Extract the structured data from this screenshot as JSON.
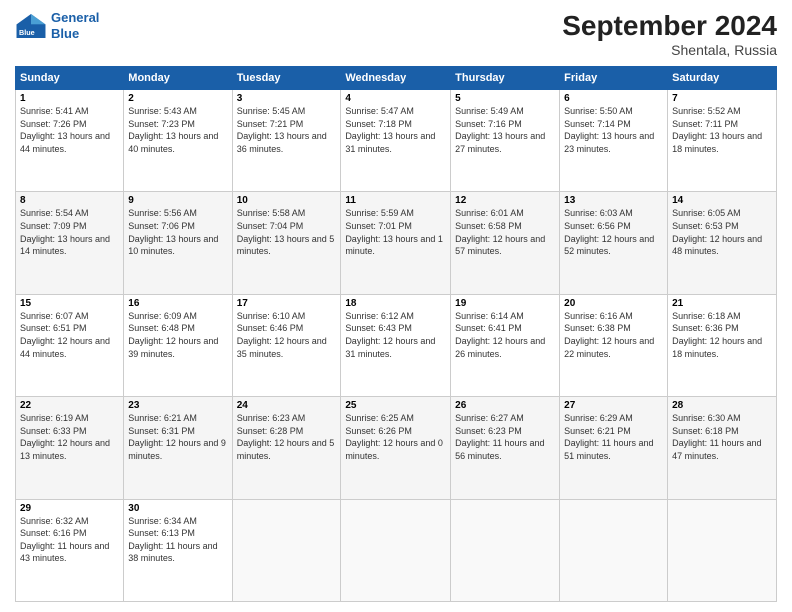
{
  "header": {
    "logo_line1": "General",
    "logo_line2": "Blue",
    "title": "September 2024",
    "subtitle": "Shentala, Russia"
  },
  "columns": [
    "Sunday",
    "Monday",
    "Tuesday",
    "Wednesday",
    "Thursday",
    "Friday",
    "Saturday"
  ],
  "weeks": [
    [
      {
        "day": "1",
        "sunrise": "5:41 AM",
        "sunset": "7:26 PM",
        "daylight": "13 hours and 44 minutes."
      },
      {
        "day": "2",
        "sunrise": "5:43 AM",
        "sunset": "7:23 PM",
        "daylight": "13 hours and 40 minutes."
      },
      {
        "day": "3",
        "sunrise": "5:45 AM",
        "sunset": "7:21 PM",
        "daylight": "13 hours and 36 minutes."
      },
      {
        "day": "4",
        "sunrise": "5:47 AM",
        "sunset": "7:18 PM",
        "daylight": "13 hours and 31 minutes."
      },
      {
        "day": "5",
        "sunrise": "5:49 AM",
        "sunset": "7:16 PM",
        "daylight": "13 hours and 27 minutes."
      },
      {
        "day": "6",
        "sunrise": "5:50 AM",
        "sunset": "7:14 PM",
        "daylight": "13 hours and 23 minutes."
      },
      {
        "day": "7",
        "sunrise": "5:52 AM",
        "sunset": "7:11 PM",
        "daylight": "13 hours and 18 minutes."
      }
    ],
    [
      {
        "day": "8",
        "sunrise": "5:54 AM",
        "sunset": "7:09 PM",
        "daylight": "13 hours and 14 minutes."
      },
      {
        "day": "9",
        "sunrise": "5:56 AM",
        "sunset": "7:06 PM",
        "daylight": "13 hours and 10 minutes."
      },
      {
        "day": "10",
        "sunrise": "5:58 AM",
        "sunset": "7:04 PM",
        "daylight": "13 hours and 5 minutes."
      },
      {
        "day": "11",
        "sunrise": "5:59 AM",
        "sunset": "7:01 PM",
        "daylight": "13 hours and 1 minute."
      },
      {
        "day": "12",
        "sunrise": "6:01 AM",
        "sunset": "6:58 PM",
        "daylight": "12 hours and 57 minutes."
      },
      {
        "day": "13",
        "sunrise": "6:03 AM",
        "sunset": "6:56 PM",
        "daylight": "12 hours and 52 minutes."
      },
      {
        "day": "14",
        "sunrise": "6:05 AM",
        "sunset": "6:53 PM",
        "daylight": "12 hours and 48 minutes."
      }
    ],
    [
      {
        "day": "15",
        "sunrise": "6:07 AM",
        "sunset": "6:51 PM",
        "daylight": "12 hours and 44 minutes."
      },
      {
        "day": "16",
        "sunrise": "6:09 AM",
        "sunset": "6:48 PM",
        "daylight": "12 hours and 39 minutes."
      },
      {
        "day": "17",
        "sunrise": "6:10 AM",
        "sunset": "6:46 PM",
        "daylight": "12 hours and 35 minutes."
      },
      {
        "day": "18",
        "sunrise": "6:12 AM",
        "sunset": "6:43 PM",
        "daylight": "12 hours and 31 minutes."
      },
      {
        "day": "19",
        "sunrise": "6:14 AM",
        "sunset": "6:41 PM",
        "daylight": "12 hours and 26 minutes."
      },
      {
        "day": "20",
        "sunrise": "6:16 AM",
        "sunset": "6:38 PM",
        "daylight": "12 hours and 22 minutes."
      },
      {
        "day": "21",
        "sunrise": "6:18 AM",
        "sunset": "6:36 PM",
        "daylight": "12 hours and 18 minutes."
      }
    ],
    [
      {
        "day": "22",
        "sunrise": "6:19 AM",
        "sunset": "6:33 PM",
        "daylight": "12 hours and 13 minutes."
      },
      {
        "day": "23",
        "sunrise": "6:21 AM",
        "sunset": "6:31 PM",
        "daylight": "12 hours and 9 minutes."
      },
      {
        "day": "24",
        "sunrise": "6:23 AM",
        "sunset": "6:28 PM",
        "daylight": "12 hours and 5 minutes."
      },
      {
        "day": "25",
        "sunrise": "6:25 AM",
        "sunset": "6:26 PM",
        "daylight": "12 hours and 0 minutes."
      },
      {
        "day": "26",
        "sunrise": "6:27 AM",
        "sunset": "6:23 PM",
        "daylight": "11 hours and 56 minutes."
      },
      {
        "day": "27",
        "sunrise": "6:29 AM",
        "sunset": "6:21 PM",
        "daylight": "11 hours and 51 minutes."
      },
      {
        "day": "28",
        "sunrise": "6:30 AM",
        "sunset": "6:18 PM",
        "daylight": "11 hours and 47 minutes."
      }
    ],
    [
      {
        "day": "29",
        "sunrise": "6:32 AM",
        "sunset": "6:16 PM",
        "daylight": "11 hours and 43 minutes."
      },
      {
        "day": "30",
        "sunrise": "6:34 AM",
        "sunset": "6:13 PM",
        "daylight": "11 hours and 38 minutes."
      },
      null,
      null,
      null,
      null,
      null
    ]
  ]
}
